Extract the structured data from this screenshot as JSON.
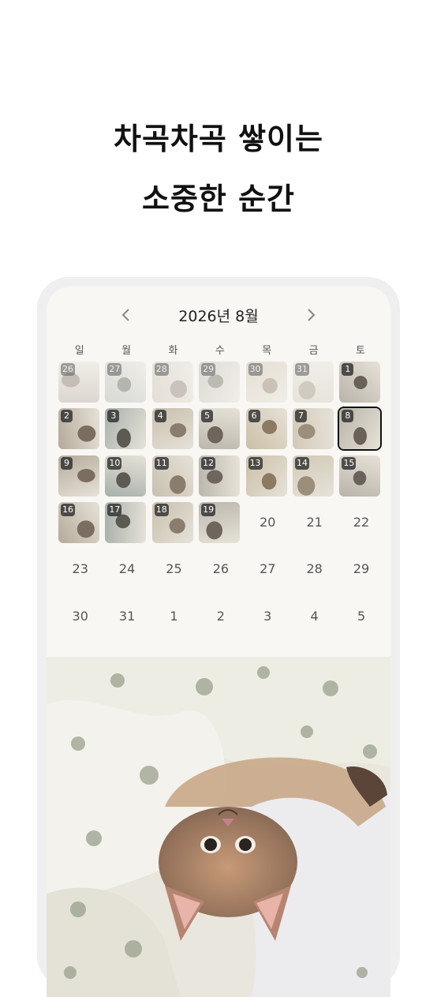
{
  "headline": {
    "line1": "차곡차곡 쌓이는",
    "line2": "소중한 순간"
  },
  "calendar": {
    "title": "2026년 8월",
    "prev_icon": "chevron-left-icon",
    "next_icon": "chevron-right-icon",
    "weekdays": [
      "일",
      "월",
      "화",
      "수",
      "목",
      "금",
      "토"
    ],
    "days": [
      {
        "label": "26",
        "photo": true,
        "dim": true
      },
      {
        "label": "27",
        "photo": true,
        "dim": true
      },
      {
        "label": "28",
        "photo": true,
        "dim": true
      },
      {
        "label": "29",
        "photo": true,
        "dim": true
      },
      {
        "label": "30",
        "photo": true,
        "dim": true
      },
      {
        "label": "31",
        "photo": true,
        "dim": true
      },
      {
        "label": "1",
        "photo": true
      },
      {
        "label": "2",
        "photo": true
      },
      {
        "label": "3",
        "photo": true
      },
      {
        "label": "4",
        "photo": true
      },
      {
        "label": "5",
        "photo": true
      },
      {
        "label": "6",
        "photo": true
      },
      {
        "label": "7",
        "photo": true
      },
      {
        "label": "8",
        "photo": true,
        "selected": true
      },
      {
        "label": "9",
        "photo": true
      },
      {
        "label": "10",
        "photo": true
      },
      {
        "label": "11",
        "photo": true
      },
      {
        "label": "12",
        "photo": true
      },
      {
        "label": "13",
        "photo": true
      },
      {
        "label": "14",
        "photo": true
      },
      {
        "label": "15",
        "photo": true
      },
      {
        "label": "16",
        "photo": true
      },
      {
        "label": "17",
        "photo": true
      },
      {
        "label": "18",
        "photo": true
      },
      {
        "label": "19",
        "photo": true
      },
      {
        "label": "20"
      },
      {
        "label": "21"
      },
      {
        "label": "22"
      },
      {
        "label": "23"
      },
      {
        "label": "24"
      },
      {
        "label": "25"
      },
      {
        "label": "26"
      },
      {
        "label": "27"
      },
      {
        "label": "28"
      },
      {
        "label": "29"
      },
      {
        "label": "30"
      },
      {
        "label": "31"
      },
      {
        "label": "1"
      },
      {
        "label": "2"
      },
      {
        "label": "3"
      },
      {
        "label": "4"
      },
      {
        "label": "5"
      }
    ]
  },
  "colors": {
    "page_bg": "#ffffff",
    "frame": "#efefef",
    "screen_bg": "#f8f7f4",
    "badge": "#282828"
  }
}
